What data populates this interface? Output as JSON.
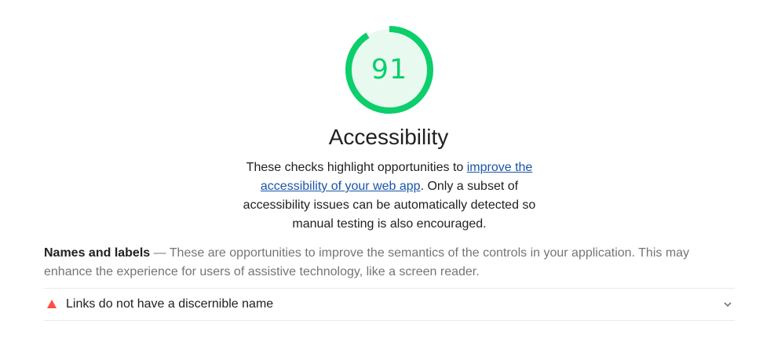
{
  "score": {
    "value": "91",
    "fraction": 0.91,
    "color": "#0cce6b",
    "fill": "#e8faf0"
  },
  "category": {
    "title": "Accessibility",
    "description_before": "These checks highlight opportunities to ",
    "description_link": "improve the accessibility of your web app",
    "description_after": ". Only a subset of accessibility issues can be automatically detected so manual testing is also encouraged."
  },
  "group": {
    "title": "Names and labels",
    "separator": " — ",
    "description": "These are opportunities to improve the semantics of the controls in your application. This may enhance the experience for users of assistive technology, like a screen reader."
  },
  "audit": {
    "title": "Links do not have a discernible name",
    "status_color": "#ff4e42",
    "icon": "fail-triangle-icon",
    "expand_icon": "chevron-down-icon"
  },
  "colors": {
    "link": "#1a55a5",
    "text": "#212121",
    "muted": "#757575"
  }
}
